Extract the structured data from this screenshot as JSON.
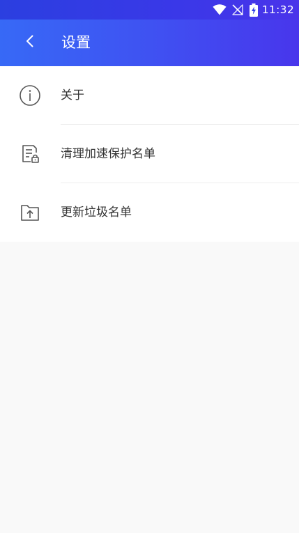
{
  "status_bar": {
    "time": "11:32",
    "icons": [
      "wifi-icon",
      "no-signal-icon",
      "battery-charging-icon"
    ]
  },
  "header": {
    "back_icon": "chevron-left-icon",
    "title": "设置",
    "gradient": [
      "#3769f6",
      "#4836ec"
    ]
  },
  "settings": {
    "items": [
      {
        "icon": "info-icon",
        "label": "关于"
      },
      {
        "icon": "document-lock-icon",
        "label": "清理加速保护名单"
      },
      {
        "icon": "folder-upload-icon",
        "label": "更新垃圾名单"
      }
    ]
  },
  "colors": {
    "text": "#333333",
    "icon": "#555555",
    "background": "#f9f9f9",
    "divider": "#ececec"
  }
}
